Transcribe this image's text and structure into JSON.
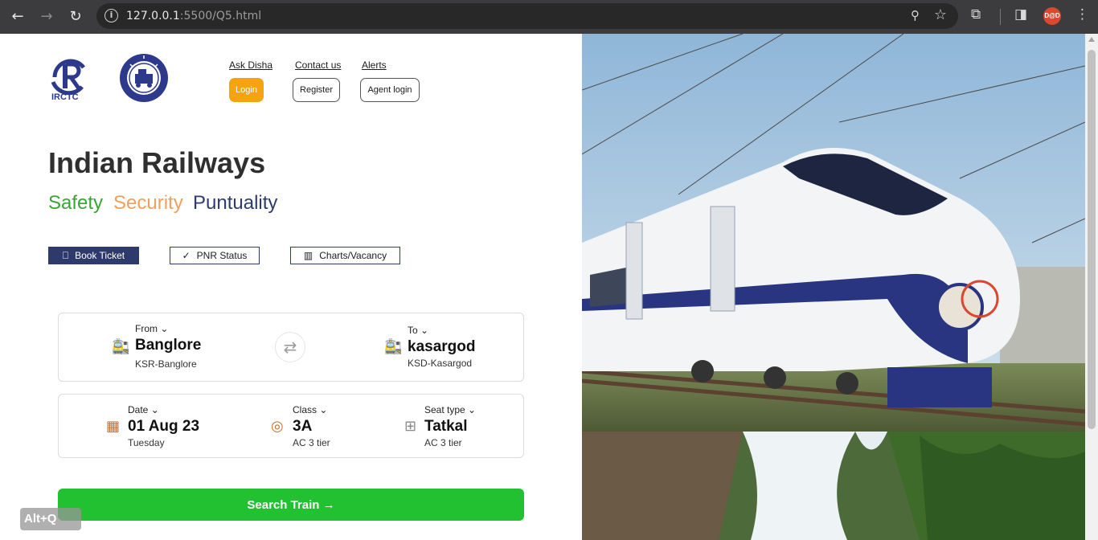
{
  "browser": {
    "url_host": "127.0.0.1",
    "url_path": ":5500/Q5.html",
    "avatar_text": "D@D"
  },
  "header": {
    "logo_irctc_text": "IRCTC",
    "links": [
      "Ask Disha",
      "Contact us",
      "Alerts"
    ],
    "buttons": {
      "login": "Login",
      "register": "Register",
      "agent_login": "Agent login"
    }
  },
  "hero": {
    "title": "Indian Railways",
    "taglines": {
      "safety": "Safety",
      "security": "Security",
      "punctuality": "Puntuality"
    }
  },
  "tabs": {
    "book_ticket": "Book Ticket",
    "pnr_status": "PNR Status",
    "charts_vacancy": "Charts/Vacancy"
  },
  "journey": {
    "from": {
      "label": "From",
      "value": "Banglore",
      "sub": "KSR-Banglore"
    },
    "to": {
      "label": "To",
      "value": "kasargod",
      "sub": "KSD-Kasargod"
    },
    "date": {
      "label": "Date",
      "value": "01 Aug 23",
      "sub": "Tuesday"
    },
    "class": {
      "label": "Class",
      "value": "3A",
      "sub": "AC 3 tier"
    },
    "seat_type": {
      "label": "Seat type",
      "value": "Tatkal",
      "sub": "AC 3 tier"
    }
  },
  "search_button": "Search Train →",
  "overlay_hint": "Alt+Q",
  "colors": {
    "accent_green": "#21c131",
    "login_orange": "#f5a40f",
    "navy": "#2d3a6b"
  }
}
